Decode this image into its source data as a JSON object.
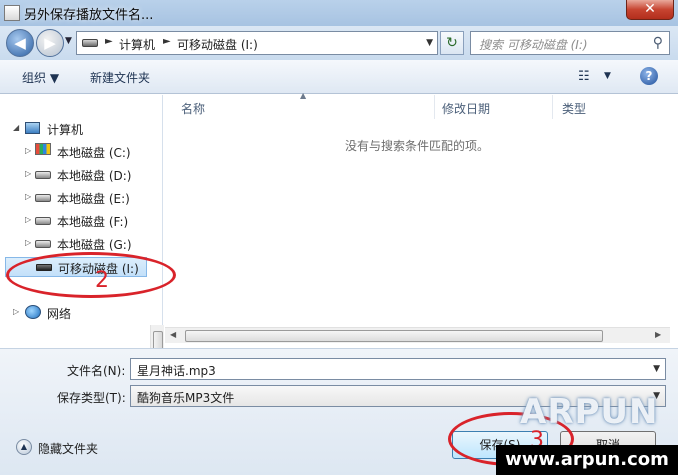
{
  "window": {
    "title": "另外保存播放文件名...",
    "close_glyph": "✕"
  },
  "addressbar": {
    "crumbs": [
      "计算机",
      "可移动磁盘 (I:)"
    ],
    "separator": "►",
    "search_placeholder": "搜索 可移动磁盘 (I:)"
  },
  "toolbar": {
    "organize": "组织 ▼",
    "new_folder": "新建文件夹"
  },
  "nav": {
    "items": [
      {
        "label": "计算机",
        "icon": "computer-icon"
      },
      {
        "label": "本地磁盘 (C:)",
        "icon": "system-drive-icon"
      },
      {
        "label": "本地磁盘 (D:)",
        "icon": "hard-drive-icon"
      },
      {
        "label": "本地磁盘 (E:)",
        "icon": "hard-drive-icon"
      },
      {
        "label": "本地磁盘 (F:)",
        "icon": "hard-drive-icon"
      },
      {
        "label": "本地磁盘 (G:)",
        "icon": "hard-drive-icon"
      },
      {
        "label": "可移动磁盘 (I:)",
        "icon": "usb-drive-icon"
      },
      {
        "label": "网络",
        "icon": "network-icon"
      }
    ],
    "selected": "可移动磁盘 (I:)"
  },
  "filelist": {
    "columns": [
      "名称",
      "修改日期",
      "类型"
    ],
    "empty_message": "没有与搜索条件匹配的项。"
  },
  "form": {
    "filename_label": "文件名(N):",
    "filename_value": "星月神话.mp3",
    "type_label": "保存类型(T):",
    "type_value": "酷狗音乐MP3文件",
    "hide_folders": "隐藏文件夹",
    "save_button": "保存(S)",
    "cancel_button": "取消"
  },
  "annotations": {
    "step2": "2",
    "step3": "3"
  },
  "watermark": {
    "logo": "ARPUN",
    "url": "www.arpun.com"
  },
  "colors": {
    "annotation_red": "#d9232a",
    "title_gradient": "#b9d1ea",
    "selected_bg": "#c3e0f9"
  }
}
